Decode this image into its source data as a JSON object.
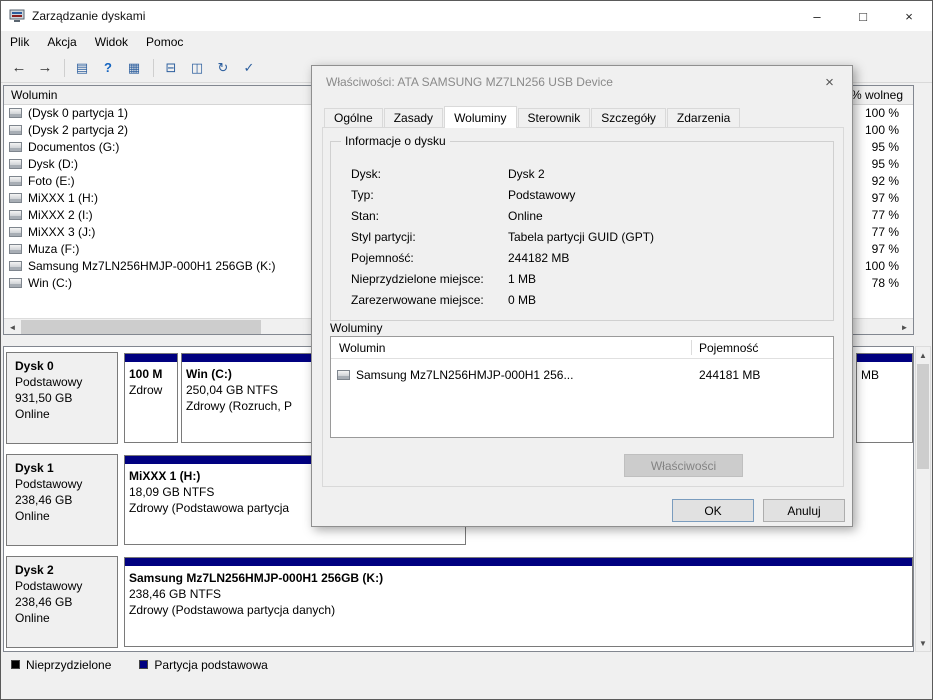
{
  "colors": {
    "primary_partition": "#000080",
    "unallocated": "#000000",
    "window_bg": "#f0f0f0"
  },
  "icons": {
    "minimize": "–",
    "maximize": "□",
    "close": "×",
    "scroll_left": "◄",
    "scroll_right": "►",
    "scroll_up": "▲",
    "scroll_down": "▼"
  },
  "window": {
    "title": "Zarządzanie dyskami"
  },
  "menu": {
    "items": [
      "Plik",
      "Akcja",
      "Widok",
      "Pomoc"
    ]
  },
  "toolbar": {
    "items": [
      {
        "name": "back",
        "glyph": "←"
      },
      {
        "name": "forward",
        "glyph": "→"
      },
      {
        "name": "show-console-tree",
        "glyph": "▤"
      },
      {
        "name": "help",
        "glyph": "?"
      },
      {
        "name": "console-window",
        "glyph": "▦"
      },
      {
        "name": "export-list",
        "glyph": "⊟"
      },
      {
        "name": "disk",
        "glyph": "◫"
      },
      {
        "name": "refresh",
        "glyph": "↻"
      },
      {
        "name": "check",
        "glyph": "✓"
      }
    ]
  },
  "volume_list": {
    "header": {
      "name": "Wolumin",
      "free": "% wolneg"
    },
    "rows": [
      {
        "name": "(Dysk 0 partycja 1)",
        "free": "100 %"
      },
      {
        "name": "(Dysk 2 partycja 2)",
        "free": "100 %"
      },
      {
        "name": "Documentos (G:)",
        "free": "95 %"
      },
      {
        "name": "Dysk (D:)",
        "free": "95 %"
      },
      {
        "name": "Foto (E:)",
        "free": "92 %"
      },
      {
        "name": "MiXXX 1 (H:)",
        "free": "97 %"
      },
      {
        "name": "MiXXX 2 (I:)",
        "free": "77 %"
      },
      {
        "name": "MiXXX 3 (J:)",
        "free": "77 %"
      },
      {
        "name": "Muza (F:)",
        "free": "97 %"
      },
      {
        "name": "Samsung Mz7LN256HMJP-000H1 256GB (K:)",
        "free": "100 %"
      },
      {
        "name": "Win (C:)",
        "free": "78 %"
      }
    ]
  },
  "disks": [
    {
      "name": "Dysk 0",
      "type": "Podstawowy",
      "size": "931,50 GB",
      "status": "Online",
      "partitions": [
        {
          "line1": "100 M",
          "line2": "Zdrow",
          "line3": ""
        },
        {
          "line1": "Win  (C:)",
          "line2": "250,04 GB NTFS",
          "line3": "Zdrowy (Rozruch, P"
        },
        {
          "line1": "",
          "line2": "MB",
          "line3": ""
        }
      ]
    },
    {
      "name": "Dysk 1",
      "type": "Podstawowy",
      "size": "238,46 GB",
      "status": "Online",
      "partitions": [
        {
          "line1": "MiXXX 1  (H:)",
          "line2": "18,09 GB NTFS",
          "line3": "Zdrowy (Podstawowa partycja"
        }
      ]
    },
    {
      "name": "Dysk 2",
      "type": "Podstawowy",
      "size": "238,46 GB",
      "status": "Online",
      "partitions": [
        {
          "line1": "Samsung Mz7LN256HMJP-000H1 256GB  (K:)",
          "line2": "238,46 GB NTFS",
          "line3": "Zdrowy (Podstawowa partycja danych)"
        }
      ]
    }
  ],
  "legend": {
    "items": [
      {
        "label": "Nieprzydzielone",
        "color": "#000000"
      },
      {
        "label": "Partycja podstawowa",
        "color": "#000080"
      }
    ]
  },
  "dialog": {
    "title": "Właściwości: ATA SAMSUNG MZ7LN256 USB Device",
    "tabs": [
      {
        "label": "Ogólne",
        "active": false
      },
      {
        "label": "Zasady",
        "active": false
      },
      {
        "label": "Woluminy",
        "active": true
      },
      {
        "label": "Sterownik",
        "active": false
      },
      {
        "label": "Szczegóły",
        "active": false
      },
      {
        "label": "Zdarzenia",
        "active": false
      }
    ],
    "group_title": "Informacje o dysku",
    "info_rows": [
      {
        "label": "Dysk:",
        "value": "Dysk 2"
      },
      {
        "label": "Typ:",
        "value": "Podstawowy"
      },
      {
        "label": "Stan:",
        "value": "Online"
      },
      {
        "label": "Styl partycji:",
        "value": "Tabela partycji GUID (GPT)"
      },
      {
        "label": "Pojemność:",
        "value": "244182 MB"
      },
      {
        "label": "Nieprzydzielone miejsce:",
        "value": "1 MB"
      },
      {
        "label": "Zarezerwowane miejsce:",
        "value": "0 MB"
      }
    ],
    "volumes_section": "Woluminy",
    "volumes_table": {
      "col_volume": "Wolumin",
      "col_capacity": "Pojemność",
      "rows": [
        {
          "volume": "Samsung Mz7LN256HMJP-000H1 256...",
          "capacity": "244181 MB"
        }
      ]
    },
    "buttons": {
      "properties": "Właściwości",
      "ok": "OK",
      "cancel": "Anuluj"
    }
  }
}
